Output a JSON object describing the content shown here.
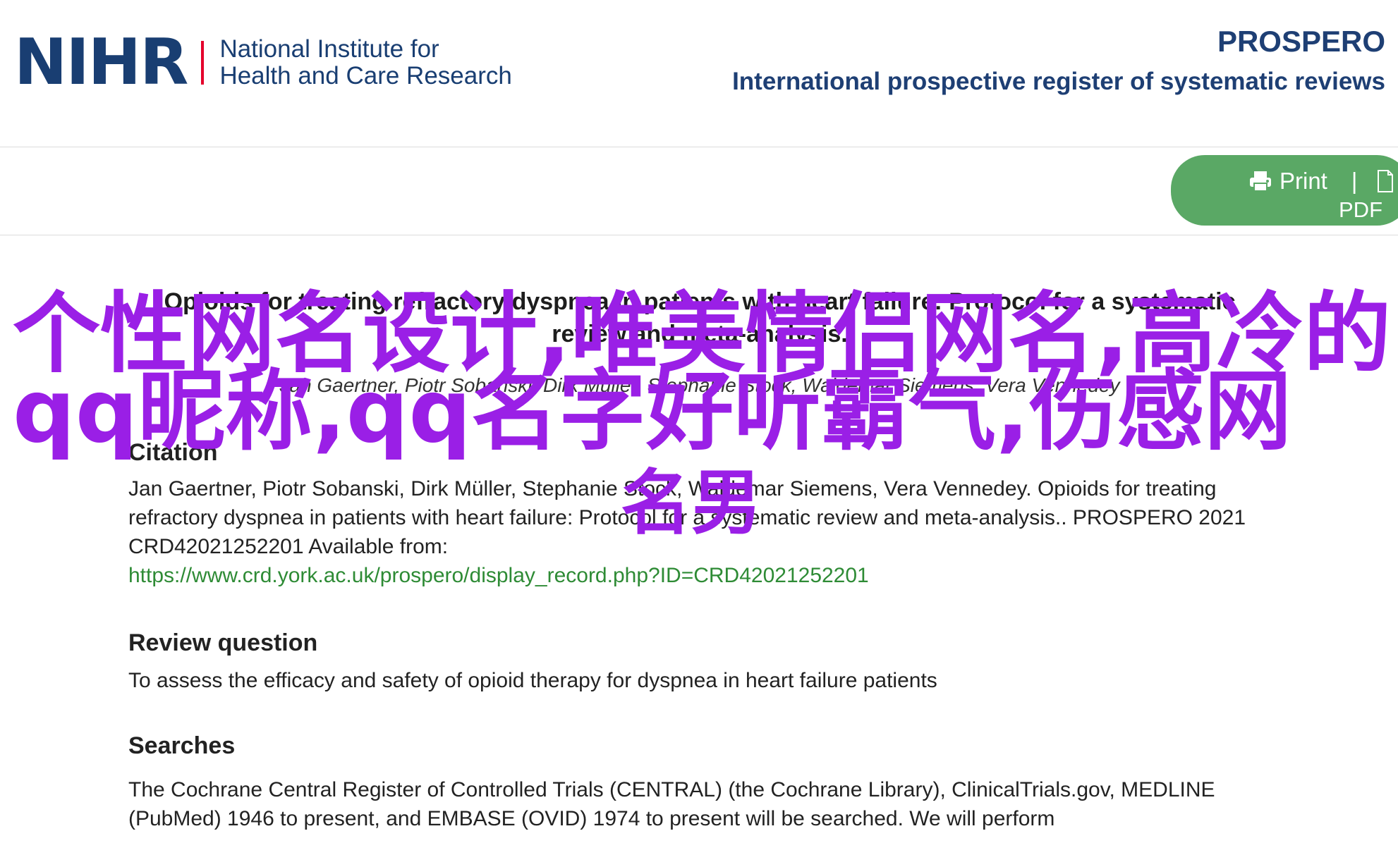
{
  "header": {
    "logo_mark": "NIHR",
    "logo_line1": "National Institute for",
    "logo_line2": "Health and Care Research",
    "register_title": "PROSPERO",
    "register_subtitle": "International prospective register of systematic reviews"
  },
  "toolbar": {
    "print_label": "Print",
    "separator": "|",
    "pdf_label": "PDF",
    "pill_color": "#5aa865"
  },
  "record": {
    "title": "Opioids for treating refractory dyspnea in patients with heart failure: Protocol for a systematic review and meta-analysis.",
    "authors": "Jan Gaertner, Piotr Sobanski, Dirk Müller, Stephanie Stock, Waldemar Siemens, Vera Vennedey",
    "citation_heading": "Citation",
    "citation_text": "Jan Gaertner, Piotr Sobanski, Dirk Müller, Stephanie Stock, Waldemar Siemens, Vera Vennedey. Opioids for treating refractory dyspnea in patients with heart failure: Protocol for a systematic review and meta-analysis.. PROSPERO 2021 CRD42021252201 Available from:",
    "citation_link": "https://www.crd.york.ac.uk/prospero/display_record.php?ID=CRD42021252201",
    "review_question_heading": "Review question",
    "review_question_text": "To assess the efficacy and safety of opioid therapy for dyspnea in heart failure patients",
    "searches_heading": "Searches",
    "searches_text": "The Cochrane Central Register of Controlled Trials (CENTRAL) (the Cochrane Library), ClinicalTrials.gov, MEDLINE (PubMed) 1946 to present, and EMBASE (OVID) 1974 to present will be searched. We will perform"
  },
  "overlay": {
    "line1": "个性网名设计,唯美情侣网名,高冷的",
    "line2": "qq昵称,qq名字好听霸气,伤感网",
    "line3": "名男",
    "color": "#9a1fe6"
  }
}
